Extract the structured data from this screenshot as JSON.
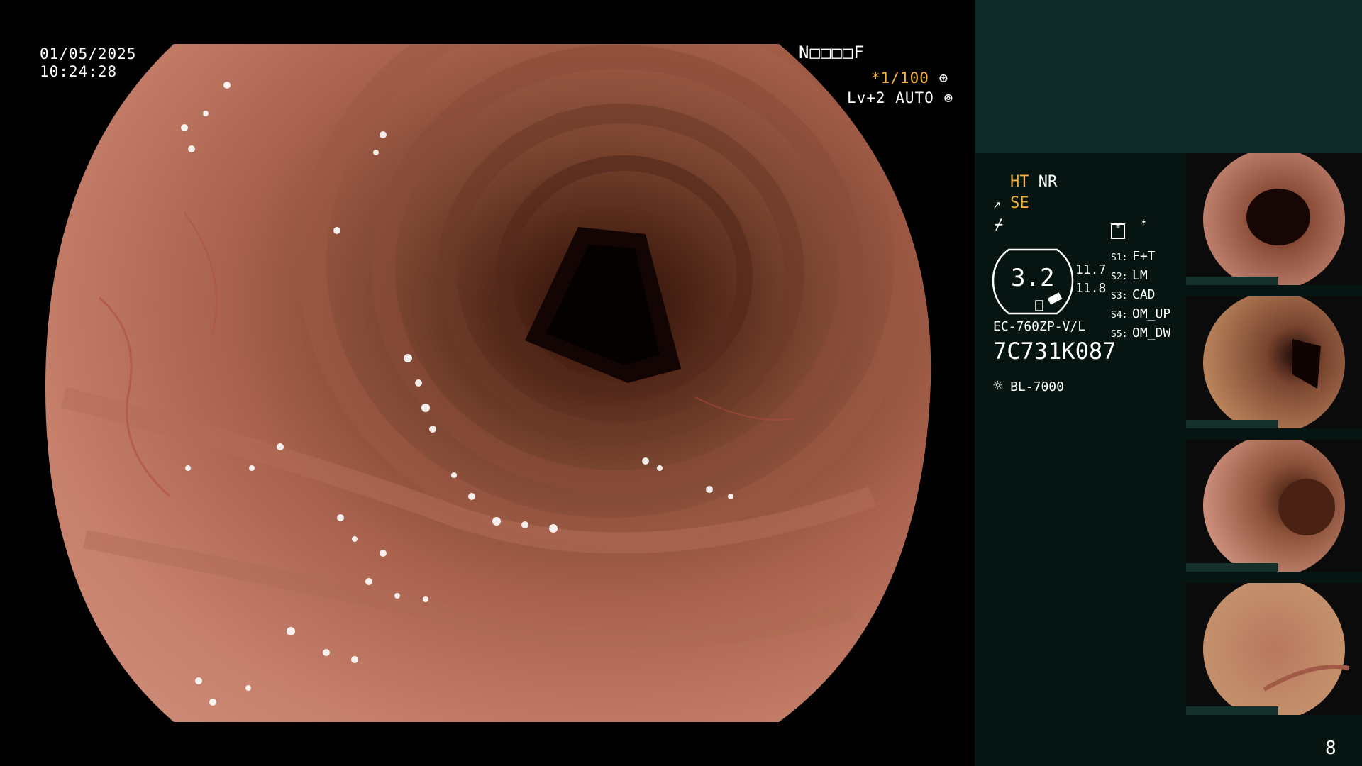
{
  "overlay": {
    "date": "01/05/2025",
    "time": "10:24:28",
    "mode_code": "N□□□□F",
    "shutter": "*1/100",
    "level": "Lv+2 AUTO"
  },
  "processor": {
    "ht_label": "HT",
    "nr_label": "NR",
    "se_label": "SE",
    "asterisk": "*",
    "gauge_value": "3.2",
    "gauge_right_top": "11.7",
    "gauge_right_bottom": "11.8",
    "scope_model": "EC-760ZP-V/L",
    "scope_serial": "7C731K087",
    "light_source": "BL-7000",
    "switches": [
      {
        "key": "S1:",
        "value": "F+T"
      },
      {
        "key": "S2:",
        "value": "LM"
      },
      {
        "key": "S3:",
        "value": "CAD"
      },
      {
        "key": "S4:",
        "value": "OM_UP"
      },
      {
        "key": "S5:",
        "value": "OM_DW"
      }
    ],
    "image_count": "8"
  },
  "colors": {
    "accent_orange": "#f6b13a",
    "panel_bg": "#061412",
    "panel_header": "#0f2a27",
    "mucosa": "#c27a66"
  },
  "thumbnails": [
    {
      "name": "capture-1"
    },
    {
      "name": "capture-2"
    },
    {
      "name": "capture-3"
    },
    {
      "name": "capture-4"
    }
  ]
}
